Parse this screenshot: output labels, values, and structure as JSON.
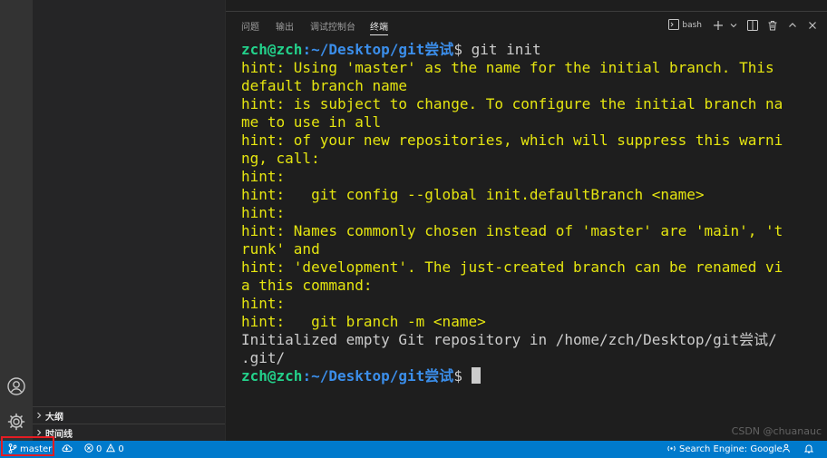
{
  "activity_bar": {
    "accounts_icon": "account-icon",
    "manage_icon": "gear-icon"
  },
  "sidebar": {
    "sections": [
      {
        "label": "大纲"
      },
      {
        "label": "时间线"
      }
    ]
  },
  "panel": {
    "tabs": [
      {
        "label": "问题"
      },
      {
        "label": "输出"
      },
      {
        "label": "调试控制台"
      },
      {
        "label": "终端",
        "active": true
      }
    ],
    "terminal_profile": "bash",
    "toolbar_icons": [
      "terminal-icon",
      "plus-icon",
      "chevron-down-icon",
      "split-icon",
      "trash-icon",
      "chevron-up-icon",
      "close-icon"
    ]
  },
  "terminal": {
    "prompt_user": "zch@zch",
    "prompt_path": ":~/Desktop/git尝试",
    "prompt_symbol": "$ ",
    "command": "git init",
    "hint_lines": [
      "hint: Using 'master' as the name for the initial branch. This",
      "default branch name",
      "hint: is subject to change. To configure the initial branch na",
      "me to use in all",
      "hint: of your new repositories, which will suppress this warni",
      "ng, call:",
      "hint:",
      "hint:   git config --global init.defaultBranch <name>",
      "hint:",
      "hint: Names commonly chosen instead of 'master' are 'main', 't",
      "runk' and",
      "hint: 'development'. The just-created branch can be renamed vi",
      "a this command:",
      "hint:",
      "hint:   git branch -m <name>"
    ],
    "output_lines": [
      "Initialized empty Git repository in /home/zch/Desktop/git尝试/",
      ".git/"
    ]
  },
  "statusbar": {
    "branch": "master",
    "errors": "0",
    "warnings": "0",
    "search_engine": "Search Engine: Google"
  },
  "watermark": "CSDN @chuanauc",
  "colors": {
    "statusbar": "#007acc",
    "prompt_user": "#23d18b",
    "prompt_path": "#3b8eea",
    "hint": "#e5e510",
    "highlight_box": "#e51c23"
  }
}
